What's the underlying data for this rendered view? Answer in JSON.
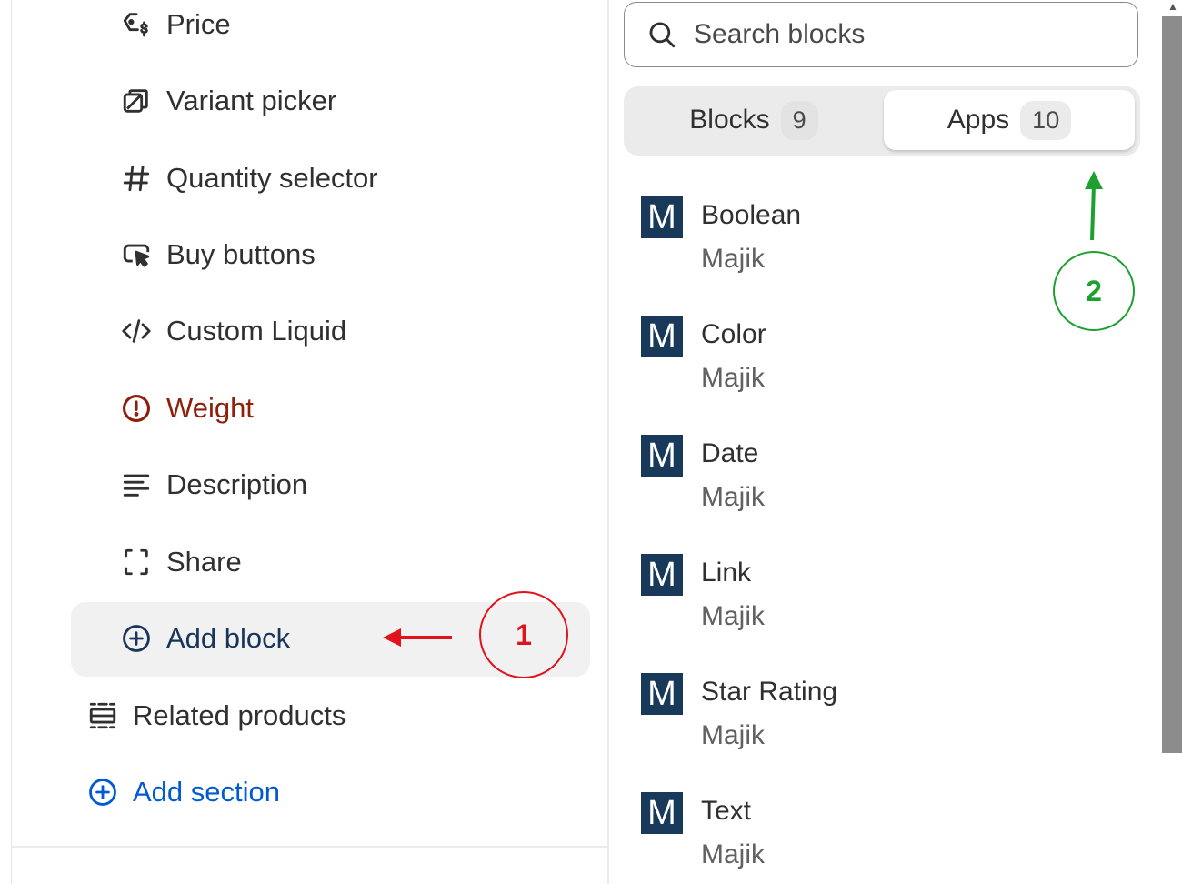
{
  "sidebar": {
    "blocks": [
      {
        "label": "Price",
        "icon": "price-tag-icon"
      },
      {
        "label": "Variant picker",
        "icon": "variant-icon"
      },
      {
        "label": "Quantity selector",
        "icon": "hash-icon"
      },
      {
        "label": "Buy buttons",
        "icon": "cursor-click-icon"
      },
      {
        "label": "Custom Liquid",
        "icon": "code-icon"
      },
      {
        "label": "Weight",
        "icon": "alert-circle-icon",
        "state": "error"
      },
      {
        "label": "Description",
        "icon": "text-lines-icon"
      },
      {
        "label": "Share",
        "icon": "share-frame-icon"
      }
    ],
    "add_block_label": "Add block",
    "related_products_label": "Related products",
    "add_section_label": "Add section"
  },
  "picker": {
    "search_placeholder": "Search blocks",
    "tabs": [
      {
        "label": "Blocks",
        "count": "9",
        "active": false
      },
      {
        "label": "Apps",
        "count": "10",
        "active": true
      }
    ],
    "apps": [
      {
        "logo": "M",
        "name": "Boolean",
        "vendor": "Majik"
      },
      {
        "logo": "M",
        "name": "Color",
        "vendor": "Majik"
      },
      {
        "logo": "M",
        "name": "Date",
        "vendor": "Majik"
      },
      {
        "logo": "M",
        "name": "Link",
        "vendor": "Majik"
      },
      {
        "logo": "M",
        "name": "Star Rating",
        "vendor": "Majik"
      },
      {
        "logo": "M",
        "name": "Text",
        "vendor": "Majik"
      }
    ]
  },
  "annotations": [
    {
      "number": "1",
      "color": "#e1121b"
    },
    {
      "number": "2",
      "color": "#1ca12f"
    }
  ],
  "colors": {
    "error": "#8e1f0b",
    "link": "#005bd3",
    "app_logo_bg": "#19395a"
  }
}
